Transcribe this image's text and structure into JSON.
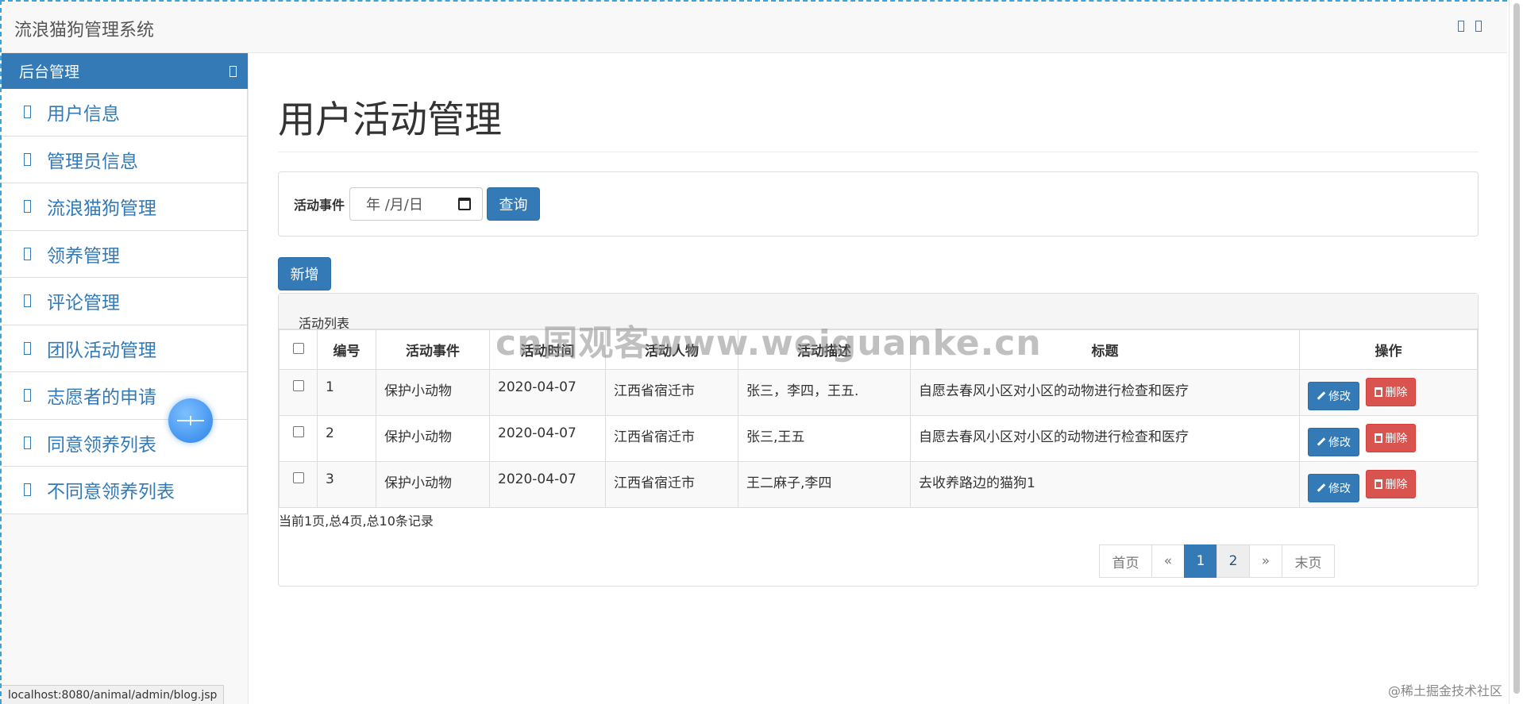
{
  "app": {
    "title": "流浪猫狗管理系统"
  },
  "sidebar": {
    "header": "后台管理",
    "items": [
      {
        "label": "用户信息"
      },
      {
        "label": "管理员信息"
      },
      {
        "label": "流浪猫狗管理"
      },
      {
        "label": "领养管理"
      },
      {
        "label": "评论管理"
      },
      {
        "label": "团队活动管理"
      },
      {
        "label": "志愿者的申请"
      },
      {
        "label": "同意领养列表"
      },
      {
        "label": "不同意领养列表"
      }
    ]
  },
  "main": {
    "title": "用户活动管理",
    "search": {
      "label": "活动事件",
      "date_placeholder": "年 /月/日",
      "button": "查询"
    },
    "add_button": "新增",
    "table": {
      "caption": "活动列表",
      "headers": [
        "编号",
        "活动事件",
        "活动时间",
        "活动人物",
        "活动描述",
        "标题",
        "操作"
      ],
      "rows": [
        {
          "id": "1",
          "event": "保护小动物",
          "date": "2020-04-07",
          "place": "江西省宿迁市",
          "people": "张三，李四，王五.",
          "title": "自愿去春风小区对小区的动物进行检查和医疗"
        },
        {
          "id": "2",
          "event": "保护小动物",
          "date": "2020-04-07",
          "place": "江西省宿迁市",
          "people": "张三,王五",
          "title": "自愿去春风小区对小区的动物进行检查和医疗"
        },
        {
          "id": "3",
          "event": "保护小动物",
          "date": "2020-04-07",
          "place": "江西省宿迁市",
          "people": "王二麻子,李四",
          "title": "去收养路边的猫狗1"
        }
      ],
      "edit_label": "修改",
      "delete_label": "删除"
    },
    "page_info": "当前1页,总4页,总10条记录",
    "pagination": {
      "first": "首页",
      "prev": "«",
      "pages": [
        "1",
        "2"
      ],
      "current": "1",
      "next": "»",
      "last": "末页"
    }
  },
  "status_url": "localhost:8080/animal/admin/blog.jsp",
  "watermark": "cn国观客www.weiguanke.cn",
  "corner_watermark": "@稀土掘金技术社区",
  "colors": {
    "primary": "#337ab7",
    "danger": "#d9534f"
  }
}
